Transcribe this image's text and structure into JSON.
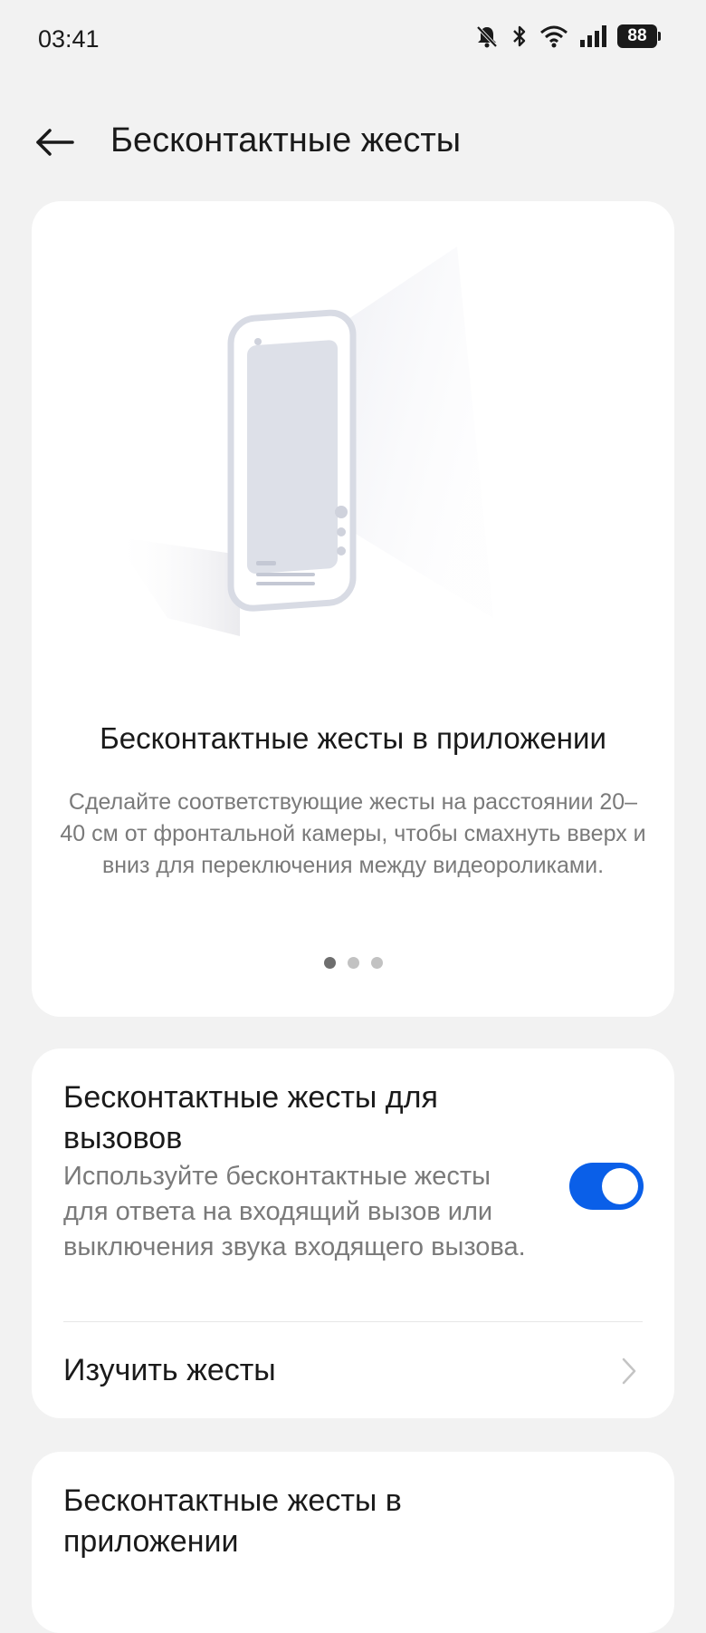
{
  "status_bar": {
    "time": "03:41",
    "battery": "88",
    "icons": [
      "mute-bell-icon",
      "bluetooth-icon",
      "wifi-icon",
      "signal-icon",
      "battery-icon"
    ]
  },
  "header": {
    "title": "Бесконтактные жесты",
    "back_icon": "arrow-left-icon"
  },
  "hero": {
    "title": "Бесконтактные жесты в приложении",
    "description": "Сделайте соответствующие жесты на расстоянии 20–40 см от фронтальной камеры, чтобы смахнуть вверх и вниз для переключения между видеороликами.",
    "pages": 3,
    "active_page": 1
  },
  "calls_setting": {
    "title": "Бесконтактные жесты для вызовов",
    "description": "Используйте бесконтактные жесты для ответа на входящий вызов или выключения звука входящего вызова.",
    "enabled": true
  },
  "learn_gestures": {
    "label": "Изучить жесты",
    "icon": "chevron-right-icon"
  },
  "apps_setting": {
    "title": "Бесконтактные жесты в приложении"
  },
  "colors": {
    "background": "#f2f2f2",
    "card": "#ffffff",
    "accent": "#0a5fe8",
    "secondary_text": "#7a7a7a"
  }
}
